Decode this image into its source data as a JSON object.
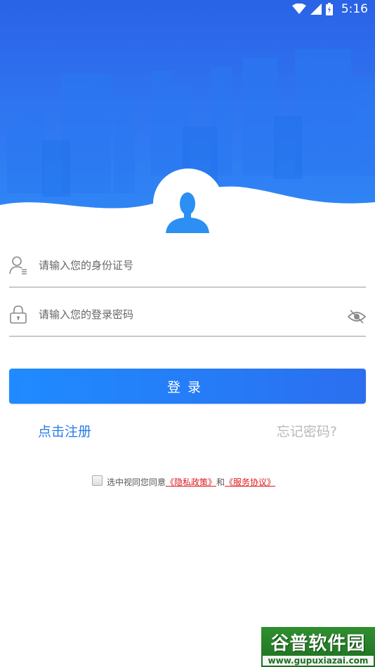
{
  "status_bar": {
    "time": "5:16",
    "icons": [
      "wifi-icon",
      "cellular-signal-icon",
      "battery-icon"
    ]
  },
  "form": {
    "id_number": {
      "placeholder": "请输入您的身份证号",
      "value": "",
      "icon": "user-id-icon"
    },
    "password": {
      "placeholder": "请输入您的登录密码",
      "value": "",
      "icon": "lock-icon",
      "toggle_icon": "eye-icon"
    }
  },
  "login_button": {
    "label": "登录"
  },
  "links": {
    "register": "点击注册",
    "forgot_password": "忘记密码?"
  },
  "agreement": {
    "checked": false,
    "prefix": "选中视同您同意",
    "privacy_policy": "《隐私政策》",
    "conjunction": "和",
    "service_agreement": "《服务协议》"
  },
  "watermark": {
    "title": "谷普软件园",
    "url": "www.gupuxiazai.com"
  },
  "colors": {
    "header_blue": "#2f73f0",
    "button_blue": "#2b7de9",
    "link_red": "#e0191e",
    "muted_gray": "#b9b9b9"
  }
}
